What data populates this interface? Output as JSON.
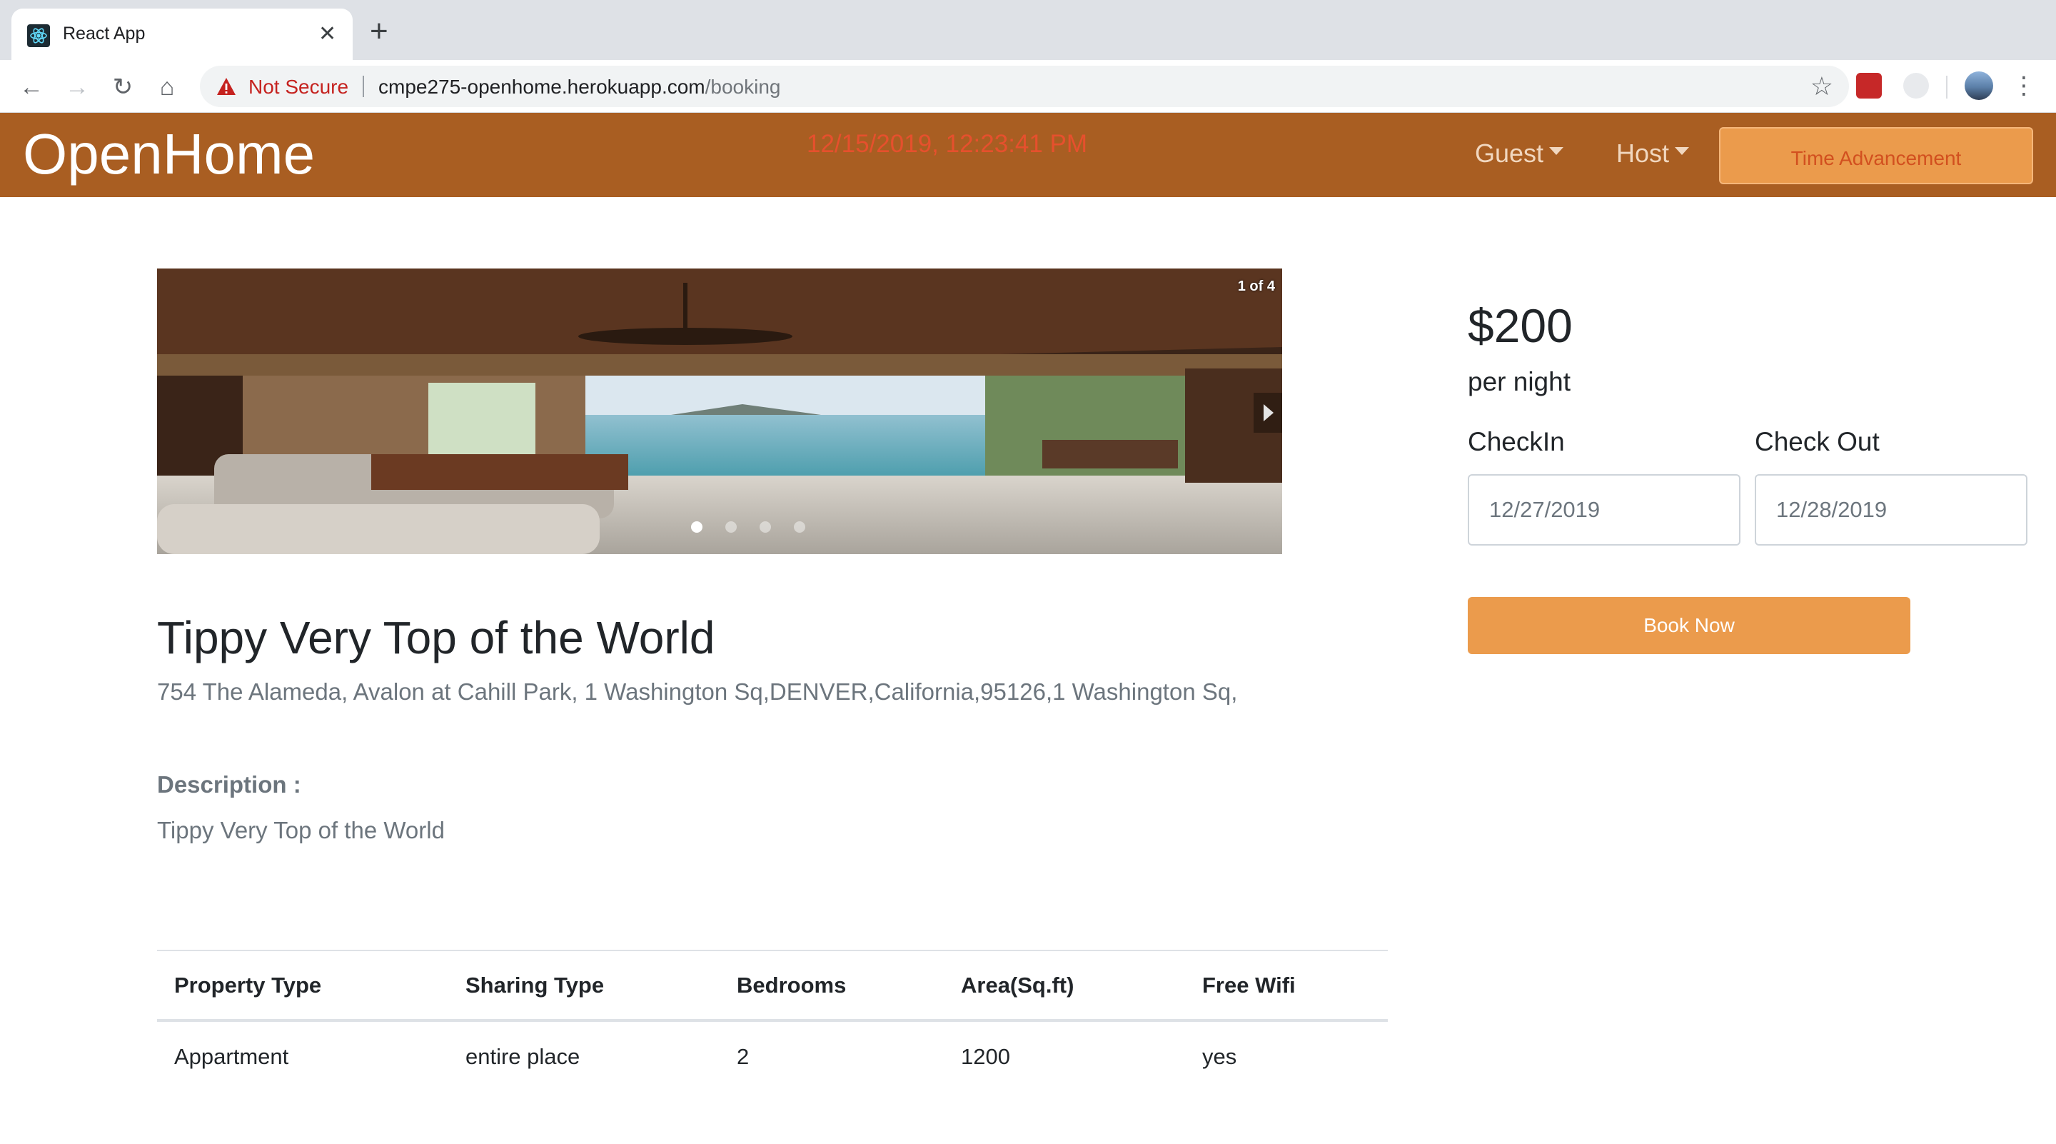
{
  "browser": {
    "tab_title": "React App",
    "security_label": "Not Secure",
    "url_host": "cmpe275-openhome.herokuapp.com",
    "url_path": "/booking"
  },
  "navbar": {
    "brand": "OpenHome",
    "clock": "12/15/2019, 12:23:41 PM",
    "guest_label": "Guest",
    "host_label": "Host",
    "time_advancement_label": "Time Advancement",
    "accent_color": "#a95e22"
  },
  "carousel": {
    "counter": "1 of 4",
    "slide_count": 4,
    "active_slide": 1
  },
  "property": {
    "title": "Tippy Very Top of the World",
    "address": "754 The Alameda, Avalon at Cahill Park, 1 Washington Sq,DENVER,California,95126,1 Washington Sq,",
    "description_label": "Description :",
    "description": "Tippy Very Top of the World"
  },
  "details": {
    "headers": [
      "Property Type",
      "Sharing Type",
      "Bedrooms",
      "Area(Sq.ft)",
      "Free Wifi"
    ],
    "row": [
      "Appartment",
      "entire place",
      "2",
      "1200",
      "yes"
    ]
  },
  "booking": {
    "price": "$200",
    "per_night": "per night",
    "checkin_label": "CheckIn",
    "checkout_label": "Check Out",
    "checkin_value": "12/27/2019",
    "checkout_value": "12/28/2019",
    "book_now_label": "Book Now",
    "button_color": "#eb9b4c"
  }
}
